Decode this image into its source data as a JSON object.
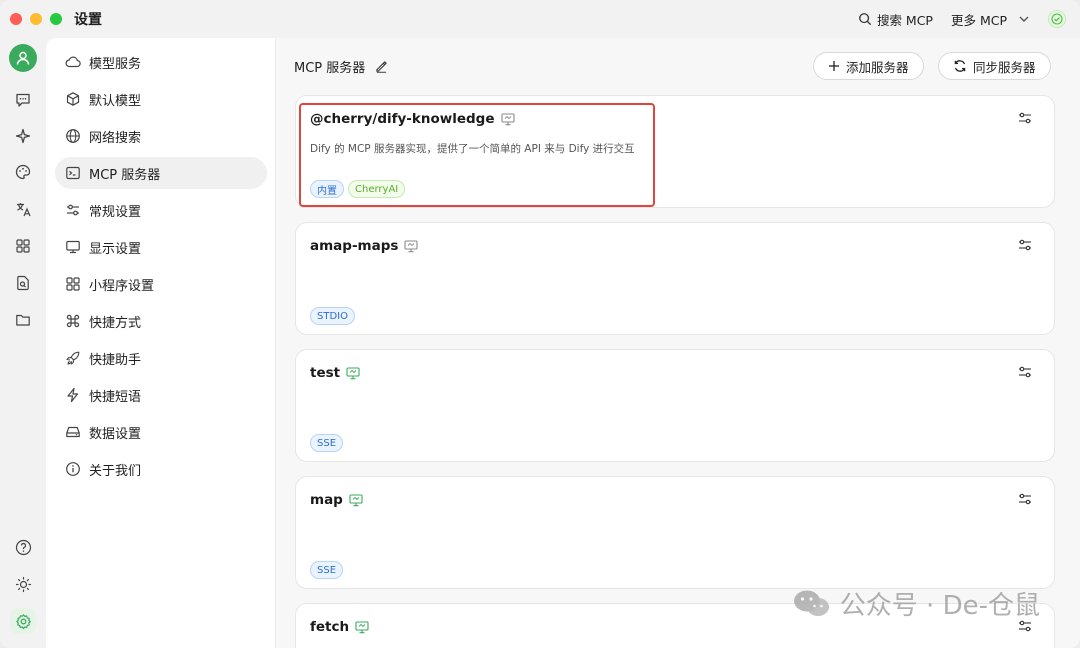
{
  "window": {
    "title": "设置"
  },
  "titlebar": {
    "search_mcp": "搜索 MCP",
    "more_mcp": "更多 MCP"
  },
  "rail": {
    "icons": [
      "user-avatar-icon",
      "chat-icon",
      "sparkle-icon",
      "palette-icon",
      "translate-icon",
      "apps-grid-icon",
      "file-search-icon",
      "folder-icon",
      "help-icon",
      "theme-sun-icon",
      "settings-gear-icon"
    ]
  },
  "sidebar": {
    "items": [
      {
        "label": "模型服务",
        "icon": "cloud-icon"
      },
      {
        "label": "默认模型",
        "icon": "cube-icon"
      },
      {
        "label": "网络搜索",
        "icon": "globe-icon"
      },
      {
        "label": "MCP 服务器",
        "icon": "terminal-icon"
      },
      {
        "label": "常规设置",
        "icon": "sliders-icon"
      },
      {
        "label": "显示设置",
        "icon": "monitor-icon"
      },
      {
        "label": "小程序设置",
        "icon": "grid-icon"
      },
      {
        "label": "快捷方式",
        "icon": "command-icon"
      },
      {
        "label": "快捷助手",
        "icon": "rocket-icon"
      },
      {
        "label": "快捷短语",
        "icon": "bolt-icon"
      },
      {
        "label": "数据设置",
        "icon": "drive-icon"
      },
      {
        "label": "关于我们",
        "icon": "info-icon"
      }
    ],
    "active_index": 3
  },
  "main": {
    "title": "MCP 服务器",
    "add_button": "添加服务器",
    "sync_button": "同步服务器"
  },
  "servers": [
    {
      "name": "@cherry/dify-knowledge",
      "description": "Dify 的 MCP 服务器实现，提供了一个简单的 API 来与 Dify 进行交互",
      "tags": [
        "内置",
        "CherryAI"
      ],
      "monitor_active": false
    },
    {
      "name": "amap-maps",
      "description": "",
      "tags": [
        "STDIO"
      ],
      "monitor_active": false
    },
    {
      "name": "test",
      "description": "",
      "tags": [
        "SSE"
      ],
      "monitor_active": true
    },
    {
      "name": "map",
      "description": "",
      "tags": [
        "SSE"
      ],
      "monitor_active": true
    },
    {
      "name": "fetch",
      "description": "",
      "tags": [],
      "monitor_active": true
    }
  ],
  "watermark": "公众号 · De-仓鼠",
  "colors": {
    "accent_green": "#3aaa5c",
    "highlight_red": "#e0463c",
    "tag_blue": "#2b6fd1"
  }
}
